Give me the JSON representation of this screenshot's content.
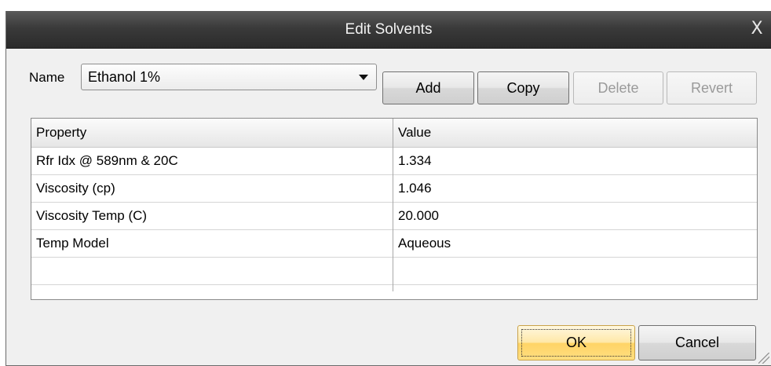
{
  "window": {
    "title": "Edit Solvents",
    "close_glyph": "X"
  },
  "name_field": {
    "label": "Name",
    "selected_value": "Ethanol 1%"
  },
  "toolbar": {
    "add_label": "Add",
    "copy_label": "Copy",
    "delete_label": "Delete",
    "revert_label": "Revert"
  },
  "grid": {
    "headers": [
      "Property",
      "Value"
    ],
    "rows": [
      [
        "Rfr Idx @ 589nm & 20C",
        "1.334"
      ],
      [
        "Viscosity (cp)",
        "1.046"
      ],
      [
        "Viscosity Temp (C)",
        "20.000"
      ],
      [
        "Temp Model",
        "Aqueous"
      ],
      [
        "",
        ""
      ]
    ]
  },
  "footer": {
    "ok_label": "OK",
    "cancel_label": "Cancel"
  },
  "icons": {
    "close": "close-icon",
    "dropdown": "chevron-down-icon",
    "resize": "resize-grip-icon"
  }
}
